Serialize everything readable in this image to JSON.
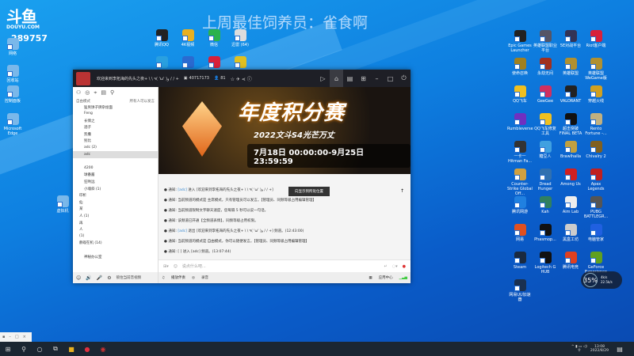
{
  "stream": {
    "logo_text": "斗鱼",
    "logo_sub": "DOUYU.COM",
    "viewer_count": "289757",
    "banner": "上周最佳饲养员：雀食啊"
  },
  "desktop_left": [
    "网络",
    "回收站",
    "控制面板",
    "Microsoft Edge",
    "虚拟机"
  ],
  "desktop_top": [
    {
      "label": "腾讯QQ",
      "color": "#222"
    },
    {
      "label": "4K视频",
      "color": "#e8b020"
    },
    {
      "label": "微信",
      "color": "#2bb24c"
    },
    {
      "label": "迅雷 (64)",
      "color": "#ddd"
    },
    {
      "label": "",
      "color": "#29a0e0"
    },
    {
      "label": "",
      "color": "#2a6ad0"
    },
    {
      "label": "",
      "color": "#d8203a"
    },
    {
      "label": "",
      "color": "#e0c020"
    }
  ],
  "desktop_right": [
    {
      "label": "Epic Games Launcher",
      "color": "#222"
    },
    {
      "label": "英雄联盟职业平台",
      "color": "#556"
    },
    {
      "label": "5E对战平台",
      "color": "#335"
    },
    {
      "label": "Riot客户端",
      "color": "#d8203a"
    },
    {
      "label": "使命召唤",
      "color": "#a08020"
    },
    {
      "label": "永劫无间",
      "color": "#a03020"
    },
    {
      "label": "英雄联盟",
      "color": "#b09030"
    },
    {
      "label": "英雄联盟WeGame版",
      "color": "#b09030"
    },
    {
      "label": "QQ飞车",
      "color": "#f0c020"
    },
    {
      "label": "GeeGee",
      "color": "#d03060"
    },
    {
      "label": "VALORANT",
      "color": "#222"
    },
    {
      "label": "穿越火线",
      "color": "#d0a020"
    },
    {
      "label": "Rumbleverse",
      "color": "#7030c0"
    },
    {
      "label": "QQ飞车修复工具",
      "color": "#f0c020"
    },
    {
      "label": "超击突破 FINAL BETA",
      "color": "#111"
    },
    {
      "label": "Rento Fortune -...",
      "color": "#c0b080"
    },
    {
      "label": "一卡一Hitman Fa...",
      "color": "#333"
    },
    {
      "label": "糖豆人",
      "color": "#40a0e0"
    },
    {
      "label": "Brawlhalla",
      "color": "#c0a040"
    },
    {
      "label": "Chivalry 2",
      "color": "#806020"
    },
    {
      "label": "Counter-Strike Global Off...",
      "color": "#d0a040"
    },
    {
      "label": "Dread Hunger",
      "color": "#3070b0"
    },
    {
      "label": "Among Us",
      "color": "#d02020"
    },
    {
      "label": "Apex Legends",
      "color": "#c02020"
    },
    {
      "label": "腾讯网游",
      "color": "#2080e0"
    },
    {
      "label": "Kah",
      "color": "#308060"
    },
    {
      "label": "Aim Lab",
      "color": "#eee"
    },
    {
      "label": "PUBG BATTLEGR...",
      "color": "#555"
    },
    {
      "label": "网易",
      "color": "#e05020"
    },
    {
      "label": "Phasmop...",
      "color": "#111"
    },
    {
      "label": "黑盒工坊",
      "color": "#ccc"
    },
    {
      "label": "电脑管家",
      "color": "#2060e0"
    },
    {
      "label": "Steam",
      "color": "#1a2a40"
    },
    {
      "label": "Logitech G HUB",
      "color": "#111"
    },
    {
      "label": "腾讯电竞",
      "color": "#e04020"
    },
    {
      "label": "GeForce Experience",
      "color": "#60a020"
    },
    {
      "label": "网易UU加速器",
      "color": "#1a3050"
    }
  ],
  "window": {
    "title": "欢迎来到李拓海的先头之夜+ \\ \\ ٩( 'ω' )و / / +",
    "room_id": "40717173",
    "fans": "81",
    "left": {
      "mode": "自由模式",
      "mode_hint": "所有人可以发言",
      "channels": [
        "猛男饼子牌杂烩面",
        "Feng",
        "长情之",
        "酒子",
        "凯撒",
        "别比",
        "adc (2)",
        "adc",
        "",
        "4200",
        "球番酱",
        "狂哟远",
        "小魂斜 (1)",
        "印析",
        "仙",
        "某",
        "人 (1)",
        "再",
        "人",
        "(1)",
        "静观在机 (14)",
        "",
        "神秘办公室"
      ]
    },
    "video": {
      "title": "年度积分赛",
      "subtitle": "2022文斗S4光芒万丈",
      "dates": "7月18日 00:00:00-9月25日 23:59:59"
    },
    "chat": [
      {
        "p": "通知:",
        "n": "[adc]",
        "t": "进入 [欢迎来到李拓海的先头之夜+ \\ \\ ٩( 'ω' )و / / +]"
      },
      {
        "p": "通知:",
        "n": "",
        "t": "当前频道的模式是 主席模式，只有管理员可以发言。【管理员、同频等级占用编辑管理】"
      },
      {
        "p": "通知:",
        "n": "",
        "t": "当前频道限制文字聊天速度，您每隔 5 秒可以说一句话。"
      },
      {
        "p": "通知:",
        "n": "",
        "t": "该频道已开通【全频道表情】，同频等级占用权限。"
      },
      {
        "p": "通知:",
        "n": "[adc]",
        "t": "退出 [欢迎来到李拓海的先头之夜+ \\ \\ ٩( 'ω' )و / / +] 频道。(12:43:00)"
      },
      {
        "p": "通知:",
        "n": "",
        "t": "当前频道的模式是 自由模式，你可以随便发言。【管理员、同频等级占用编辑管理】"
      },
      {
        "p": "通知:",
        "n": "",
        "t": "[ ] 进入 [adc] 频道。(13:07:44)"
      }
    ],
    "tooltip": "向显示到所处位置",
    "input_placeholder": "说点什么吧...",
    "bottom": {
      "bgm": "播放伴奏",
      "record": "录音",
      "app_center": "应用中心",
      "lock": "锁住当前音视频"
    }
  },
  "widget": {
    "percent": "35%",
    "up": "4k/s",
    "down": "22.5k/s"
  },
  "taskbar": {
    "time": "13:08",
    "date": "2022/8/29"
  }
}
